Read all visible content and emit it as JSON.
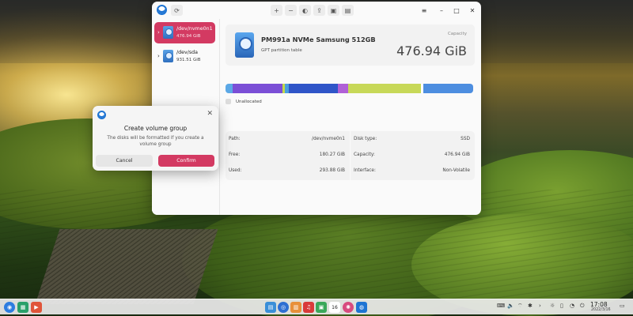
{
  "window": {
    "sidebar": {
      "disks": [
        {
          "name": "/dev/nvme0n1",
          "size": "476.94 GiB",
          "active": true
        },
        {
          "name": "/dev/sda",
          "size": "931.51 GiB",
          "active": false
        }
      ]
    },
    "header": {
      "model": "PM991a NVMe Samsung 512GB",
      "partition_table": "GPT partition table",
      "capacity_label": "Capacity",
      "capacity_value": "476.94 GiB"
    },
    "partition_bar": {
      "segments": [
        {
          "color": "#5ba8e6",
          "fraction": 0.03
        },
        {
          "color": "#7b4fd6",
          "fraction": 0.2
        },
        {
          "color": "#c3d948",
          "fraction": 0.01
        },
        {
          "color": "#4aa0de",
          "fraction": 0.015
        },
        {
          "color": "#2f55c8",
          "fraction": 0.2
        },
        {
          "color": "#b060d6",
          "fraction": 0.04
        },
        {
          "color": "#c7d858",
          "fraction": 0.295
        },
        {
          "color": "#ffffff",
          "fraction": 0.01
        },
        {
          "color": "#4d8ee0",
          "fraction": 0.2
        }
      ],
      "legend": {
        "label": "Unallocated",
        "color": "#dcdcdc"
      }
    },
    "info": {
      "path_label": "Path:",
      "path_value": "/dev/nvme0n1",
      "disk_type_label": "Disk type:",
      "disk_type_value": "SSD",
      "free_label": "Free:",
      "free_value": "180.27 GiB",
      "capacity_label": "Capacity:",
      "capacity_value": "476.94 GiB",
      "used_label": "Used:",
      "used_value": "293.88 GiB",
      "interface_label": "Interface:",
      "interface_value": "Non-Volatile"
    },
    "toolbar_icons": [
      "refresh-icon",
      "plus-icon",
      "minus-icon",
      "partition-icon",
      "upload-icon",
      "lock-icon",
      "format-icon"
    ],
    "controls": {
      "menu": "≡",
      "minimize": "–",
      "maximize": "□",
      "close": "✕"
    }
  },
  "dialog": {
    "title": "Create volume group",
    "message": "The disks will be formatted if you create a volume group",
    "cancel_label": "Cancel",
    "confirm_label": "Confirm",
    "close_glyph": "✕",
    "accent": "#d33a62"
  },
  "taskbar": {
    "time": "17:08",
    "date": "2022/3/16",
    "calendar_day": "16"
  }
}
